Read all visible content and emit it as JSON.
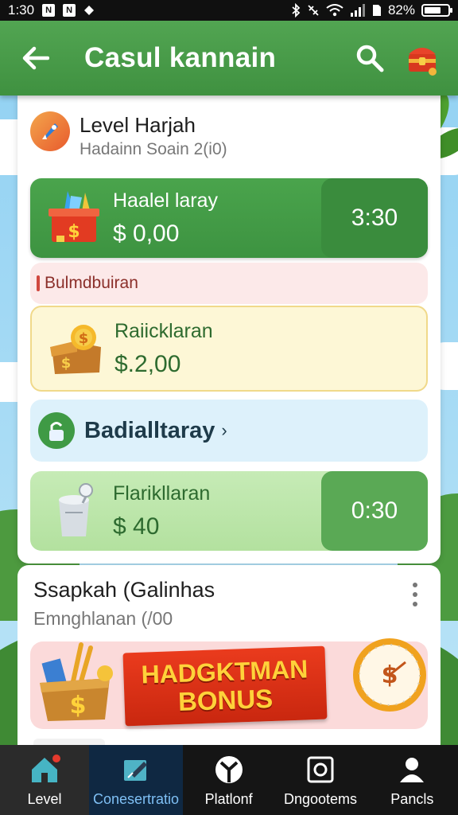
{
  "status_bar": {
    "time": "1:30",
    "battery_text": "82%"
  },
  "app_bar": {
    "title": "Casul kannain"
  },
  "level": {
    "title": "Level Harjah",
    "subtitle": "Hadainn Soain 2(i0)"
  },
  "rows": [
    {
      "name": "Haalel laray",
      "amount": "$ 0,00",
      "timer": "3:30"
    },
    {
      "label": "Bulmdbuiran"
    },
    {
      "name": "Raiicklaran",
      "amount": "$.2,00"
    },
    {
      "name": "Badialltaray",
      "arrow": "›"
    },
    {
      "name": "Flarikllaran",
      "amount": "$ 40",
      "timer": "0:30"
    }
  ],
  "section": {
    "title": "Ssapkah (Galinhas",
    "subtitle": "Emnghlanan (/00",
    "bonus_line1": "HADGKTMAN",
    "bonus_line2": "BONUS"
  },
  "bottom_nav": [
    {
      "label": "Level",
      "icon": "home-icon"
    },
    {
      "label": "Conesertratio",
      "icon": "edit-board-icon"
    },
    {
      "label": "Platlonf",
      "icon": "platform-icon"
    },
    {
      "label": "Dngootems",
      "icon": "camera-icon"
    },
    {
      "label": "Pancls",
      "icon": "user-icon"
    }
  ],
  "colors": {
    "primary_green": "#4aa44c",
    "timer_green": "#3a8c3d",
    "active_nav_blue": "#7fc0f5",
    "bonus_red": "#e13418",
    "bonus_yellow": "#ffd23a"
  }
}
